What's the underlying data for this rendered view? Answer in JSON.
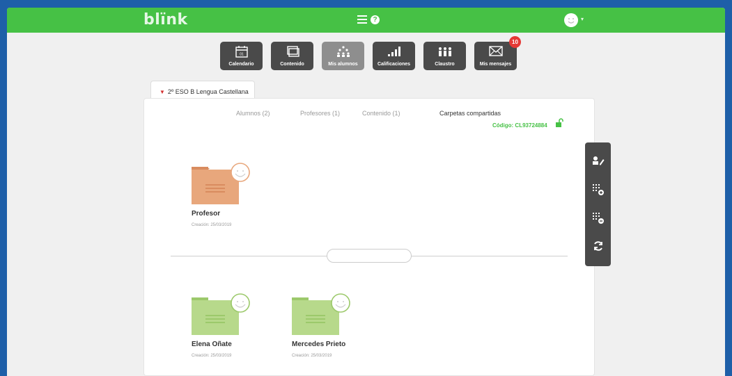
{
  "app": {
    "logo": "blïnk"
  },
  "header": {
    "menu_icon": "hamburger-icon",
    "help_icon": "help-icon",
    "help_glyph": "?",
    "user_caret": "▾"
  },
  "toolbar": [
    {
      "label": "Calendario",
      "icon": "calendar-icon",
      "active": false
    },
    {
      "label": "Contenido",
      "icon": "content-icon",
      "active": false
    },
    {
      "label": "Mis alumnos",
      "icon": "students-icon",
      "active": true
    },
    {
      "label": "Calificaciones",
      "icon": "grades-icon",
      "active": false
    },
    {
      "label": "Claustro",
      "icon": "staff-icon",
      "active": false
    },
    {
      "label": "Mis mensajes",
      "icon": "mail-icon",
      "active": false,
      "badge": "10"
    }
  ],
  "calendar_day": "01",
  "course": {
    "tab_label": "2º ESO B Lengua Castellana"
  },
  "subtabs": [
    {
      "label": "Alumnos (2)",
      "active": false
    },
    {
      "label": "Profesores (1)",
      "active": false
    },
    {
      "label": "Contenido (1)",
      "active": false
    },
    {
      "label": "Carpetas compartidas",
      "active": true
    }
  ],
  "class_code": "Código: CL93724884",
  "teacher_folders": [
    {
      "name": "Profesor",
      "created": "Creación: 25/03/2019",
      "color": "#e8a77c"
    }
  ],
  "student_folders": [
    {
      "name": "Elena Oñate",
      "created": "Creación: 25/03/2019",
      "color": "#b7d98b"
    },
    {
      "name": "Mercedes Prieto",
      "created": "Creación: 25/03/2019",
      "color": "#b7d98b"
    }
  ],
  "search": {
    "value": ""
  },
  "side_tools": [
    "edit-user-icon",
    "add-grid-icon",
    "remove-grid-icon",
    "refresh-icon"
  ],
  "colors": {
    "brand": "#46c145",
    "badge": "#e53935",
    "teacher_folder": "#e8a77c",
    "student_folder": "#b7d98b"
  }
}
